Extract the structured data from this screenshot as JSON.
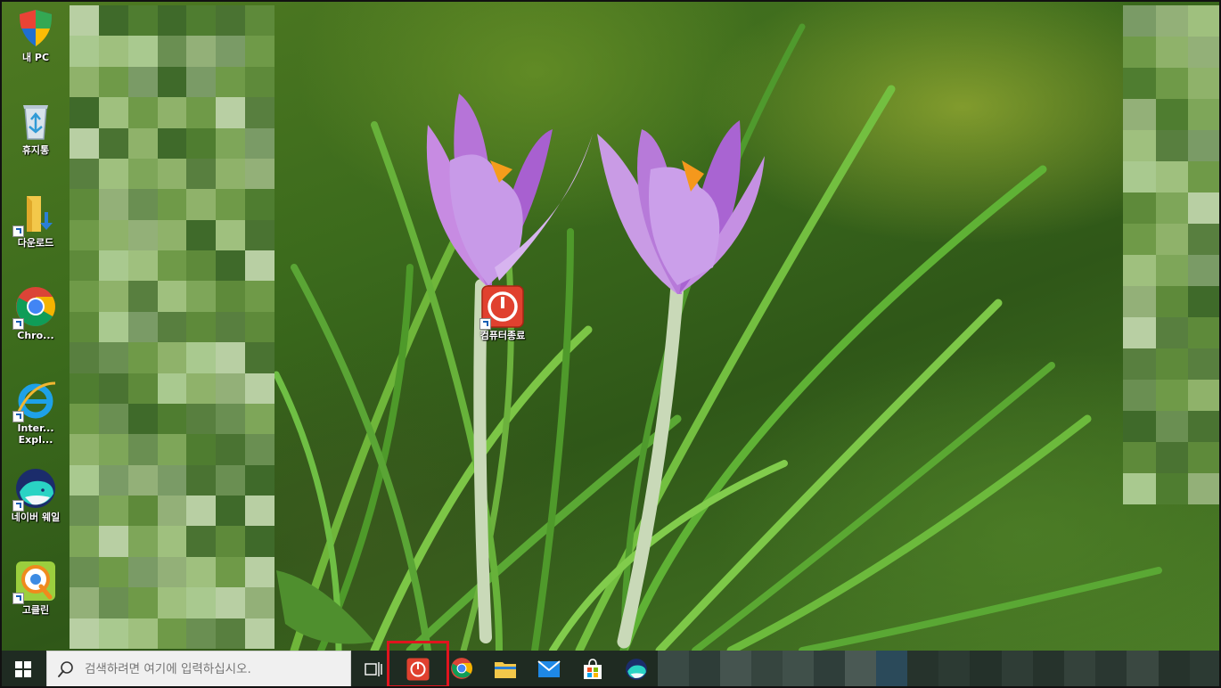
{
  "desktop": {
    "icons": [
      {
        "label": "내 PC",
        "icon": "this-pc-icon"
      },
      {
        "label": "휴지통",
        "icon": "recycle-bin-icon"
      },
      {
        "label": "다운로드",
        "icon": "downloads-folder-icon"
      },
      {
        "label": "Chro...",
        "icon": "chrome-icon"
      },
      {
        "label": "Inter... Expl...",
        "icon": "internet-explorer-icon"
      },
      {
        "label": "네이버 웨일",
        "icon": "naver-whale-icon"
      },
      {
        "label": "고클린",
        "icon": "goclean-icon"
      }
    ],
    "center_icon": {
      "label": "컴퓨터종료",
      "icon": "shutdown-icon"
    }
  },
  "taskbar": {
    "search_placeholder": "검색하려면 여기에 입력하십시오.",
    "pinned": [
      {
        "name": "shutdown",
        "icon": "shutdown-icon",
        "highlighted": true
      },
      {
        "name": "chrome",
        "icon": "chrome-icon",
        "active": true
      },
      {
        "name": "file-explorer",
        "icon": "folder-icon"
      },
      {
        "name": "mail",
        "icon": "mail-icon"
      },
      {
        "name": "store",
        "icon": "store-icon"
      },
      {
        "name": "whale",
        "icon": "naver-whale-icon"
      }
    ],
    "highlight_color": "#e0141e"
  },
  "colors": {
    "taskbar_bg": "#1f2b22",
    "search_bg": "#f0f0f0",
    "shutdown_red": "#e0412f"
  }
}
